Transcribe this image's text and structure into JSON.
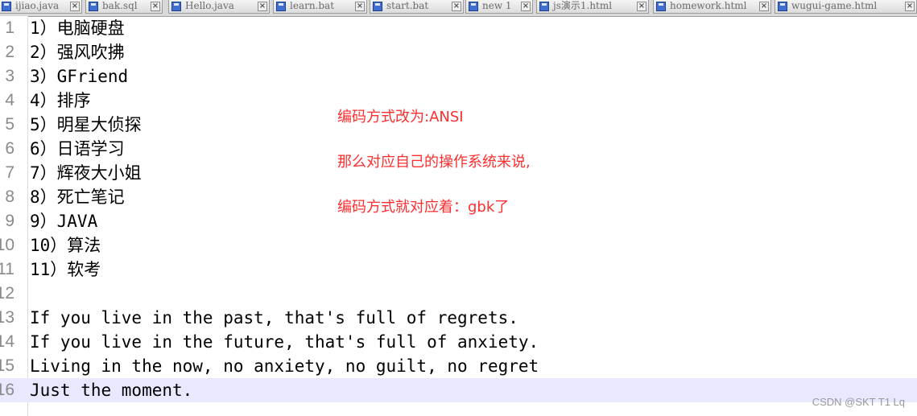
{
  "tabs": [
    {
      "name": "ijiao.java"
    },
    {
      "name": "bak.sql"
    },
    {
      "name": "Hello.java"
    },
    {
      "name": "learn.bat"
    },
    {
      "name": "start.bat"
    },
    {
      "name": "new 1"
    },
    {
      "name": "js演示1.html"
    },
    {
      "name": "homework.html"
    },
    {
      "name": "wugui-game.html"
    }
  ],
  "tab_close_glyph": "×",
  "lines": [
    {
      "num": "1",
      "text": "1）电脑硬盘"
    },
    {
      "num": "2",
      "text": "2）强风吹拂"
    },
    {
      "num": "3",
      "text": "3）GFriend"
    },
    {
      "num": "4",
      "text": "4）排序"
    },
    {
      "num": "5",
      "text": "5）明星大侦探"
    },
    {
      "num": "6",
      "text": "6）日语学习"
    },
    {
      "num": "7",
      "text": "7）辉夜大小姐"
    },
    {
      "num": "8",
      "text": "8）死亡笔记"
    },
    {
      "num": "9",
      "text": "9）JAVA"
    },
    {
      "num": "10",
      "text": "10）算法"
    },
    {
      "num": "11",
      "text": "11）软考"
    },
    {
      "num": "12",
      "text": ""
    },
    {
      "num": "13",
      "text": "If you live in the past, that's full of regrets."
    },
    {
      "num": "14",
      "text": "If you live in the future, that's full of anxiety."
    },
    {
      "num": "15",
      "text": "Living in the now, no anxiety, no guilt, no regret"
    },
    {
      "num": "16",
      "text": "Just the moment."
    }
  ],
  "current_line": 16,
  "annotation": {
    "line1": "编码方式改为:ANSI",
    "line2": "那么对应自己的操作系统来说,",
    "line3": "编码方式就对应着：gbk了"
  },
  "watermark": "CSDN @SKT T1 Lq",
  "colors": {
    "annotation": "#ff2e2e",
    "current_line_bg": "#e8e8ff",
    "line_number": "#8a8a8a",
    "tab_icon": "#3f6fd0"
  }
}
